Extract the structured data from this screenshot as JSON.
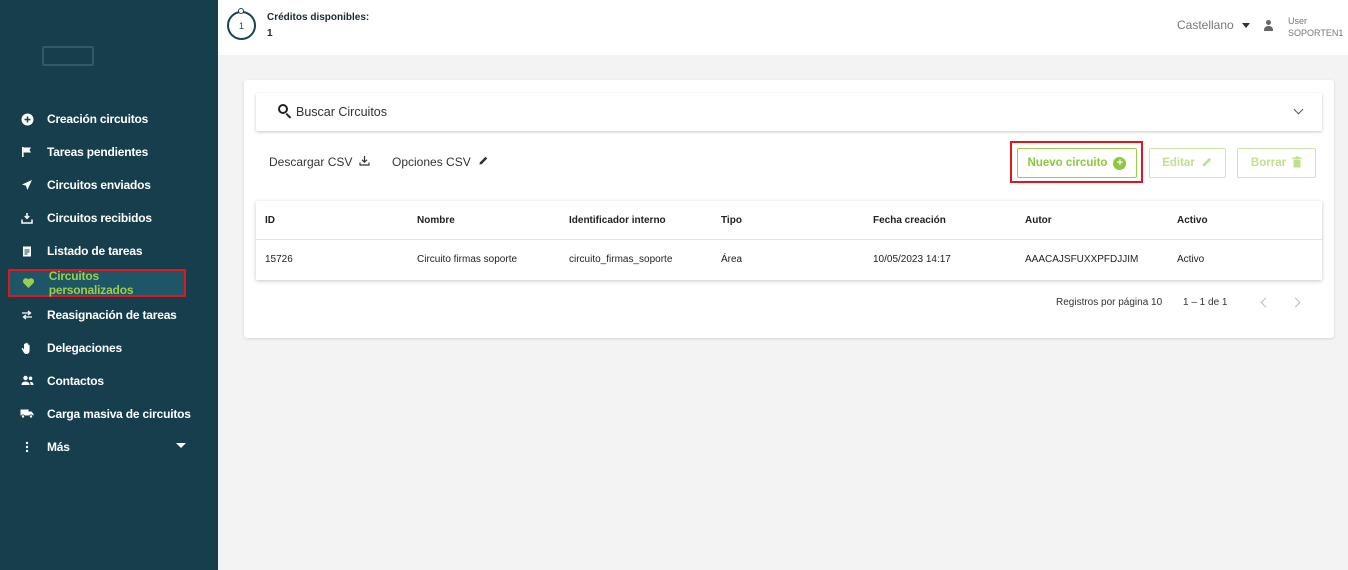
{
  "topbar": {
    "credits_count": "1",
    "credits_label": "Créditos disponibles:",
    "credits_value": "1",
    "language": "Castellano",
    "user_label": "User",
    "user_name": "SOPORTEN1"
  },
  "sidebar": {
    "items": [
      {
        "label": "Creación circuitos",
        "icon": "plus-circle-icon"
      },
      {
        "label": "Tareas pendientes",
        "icon": "flag-icon"
      },
      {
        "label": "Circuitos enviados",
        "icon": "send-icon"
      },
      {
        "label": "Circuitos recibidos",
        "icon": "inbox-icon"
      },
      {
        "label": "Listado de tareas",
        "icon": "clipboard-icon"
      },
      {
        "label": "Circuitos personalizados",
        "icon": "heart-icon"
      },
      {
        "label": "Reasignación de tareas",
        "icon": "swap-icon"
      },
      {
        "label": "Delegaciones",
        "icon": "hand-icon"
      },
      {
        "label": "Contactos",
        "icon": "contacts-icon"
      },
      {
        "label": "Carga masiva de circuitos",
        "icon": "truck-icon"
      },
      {
        "label": "Más",
        "icon": "more-vertical-icon"
      }
    ]
  },
  "search": {
    "label": "Buscar Circuitos"
  },
  "toolbar": {
    "download_csv": "Descargar CSV",
    "csv_options": "Opciones CSV",
    "new_circuit": "Nuevo circuito",
    "edit": "Editar",
    "delete": "Borrar"
  },
  "table": {
    "columns": [
      "ID",
      "Nombre",
      "Identificador interno",
      "Tipo",
      "Fecha creación",
      "Autor",
      "Activo"
    ],
    "rows": [
      [
        "15726",
        "Circuito firmas soporte",
        "circuito_firmas_soporte",
        "Área",
        "10/05/2023 14:17",
        "AAACAJSFUXXPFDJJIM",
        "Activo"
      ]
    ]
  },
  "pagination": {
    "per_page_label": "Registros por página 10",
    "range": "1 – 1 de 1"
  },
  "colors": {
    "sidebar_bg": "#163e4d",
    "accent_green": "#8cc83a",
    "highlight_red": "#e4161b"
  }
}
